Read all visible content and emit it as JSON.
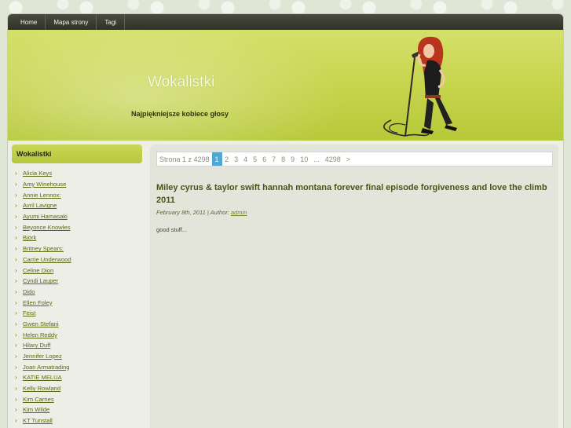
{
  "nav": {
    "items": [
      "Home",
      "Mapa strony",
      "Tagi"
    ]
  },
  "header": {
    "title": "Wokalistki",
    "tagline": "Najpiękniejsze kobiece głosy"
  },
  "sidebar": {
    "heading": "Wokalistki",
    "items": [
      "Alicia Keys",
      "Amy Winehouse",
      "Annie Lennox:",
      "Avril Lavigne",
      "Ayumi Hamasaki",
      "Beyonce Knowles",
      "Björk",
      "Britney Spears:",
      "Carrie Underwood",
      "Celine Dion",
      "Cyndi Lauper",
      "Dido",
      "Ellen Foley",
      "Feist",
      "Gwen Stefani",
      "Helen Reddy",
      "Hilary Duff",
      "Jennifer Lopez",
      "Joan Armatrading",
      "KATIE MELUA",
      "Kelly Rowland",
      "Kim Carnes",
      "Kim Wilde",
      "KT Tunstall"
    ]
  },
  "pager": {
    "label": "Strona 1 z 4298",
    "current": "1",
    "pages": [
      "2",
      "3",
      "4",
      "5",
      "6",
      "7",
      "8",
      "9",
      "10"
    ],
    "ellipsis": "...",
    "last": "4298",
    "next": ">"
  },
  "post": {
    "title": "Miley cyrus & taylor swift hannah montana forever final episode forgiveness and love the climb 2011",
    "date": "February 8th, 2011",
    "author_prefix": "| Author:",
    "author": "admin",
    "excerpt": "good stuff..."
  },
  "colors": {
    "nav_bg": "#2f3029",
    "header_green": "#c4d34a",
    "pager_active": "#4ea8d6",
    "link_green": "#5b6a12"
  }
}
